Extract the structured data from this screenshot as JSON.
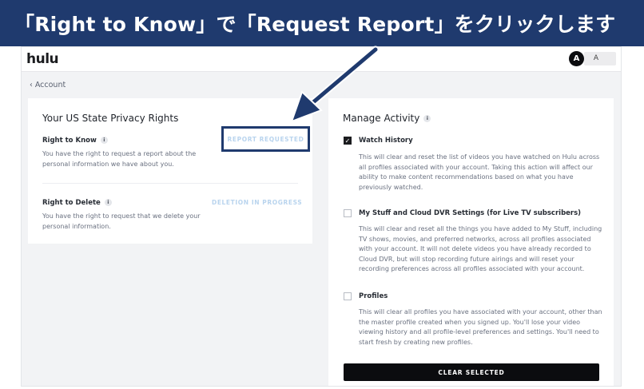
{
  "banner": {
    "text": "「Right to Know」で「Request Report」をクリックします"
  },
  "header": {
    "logo": "hulu",
    "avatar_initial": "A",
    "avatar_name": "A"
  },
  "breadcrumb": {
    "label": "Account"
  },
  "privacy": {
    "title": "Your US State Privacy Rights",
    "know": {
      "label": "Right to Know",
      "desc_line1": "You have the right to request a report about the",
      "desc_line2": "personal information we have about you.",
      "action": "REPORT REQUESTED"
    },
    "delete": {
      "label": "Right to Delete",
      "desc_line1": "You have the right to request that we delete your",
      "desc_line2": "personal information.",
      "action": "DELETION IN PROGRESS"
    }
  },
  "activity": {
    "title": "Manage Activity",
    "items": [
      {
        "label": "Watch History",
        "checked": true,
        "lines": [
          "This will clear and reset the list of videos you have watched on Hulu across",
          "all profiles associated with your account. Taking this action will affect our",
          "ability to make content recommendations based on what you have",
          "previously watched."
        ]
      },
      {
        "label": "My Stuff and Cloud DVR Settings (for Live TV subscribers)",
        "checked": false,
        "lines": [
          "This will clear and reset all the things you have added to My Stuff, including",
          "TV shows, movies, and preferred networks, across all profiles associated",
          "with your account. It will not delete videos you have already recorded to",
          "Cloud DVR, but will stop recording future airings and will reset your",
          "recording preferences across all profiles associated with your account."
        ]
      },
      {
        "label": "Profiles",
        "checked": false,
        "lines": [
          "This will clear all profiles you have associated with your account, other than",
          "the master profile created when you signed up. You'll lose your video",
          "viewing history and all profile-level preferences and settings. You'll need to",
          "start fresh by creating new profiles."
        ]
      }
    ],
    "clear_button": "CLEAR SELECTED"
  },
  "colors": {
    "banner": "#1f3a6e",
    "link_disabled": "#b9d4ee",
    "button": "#0b0c0f"
  }
}
